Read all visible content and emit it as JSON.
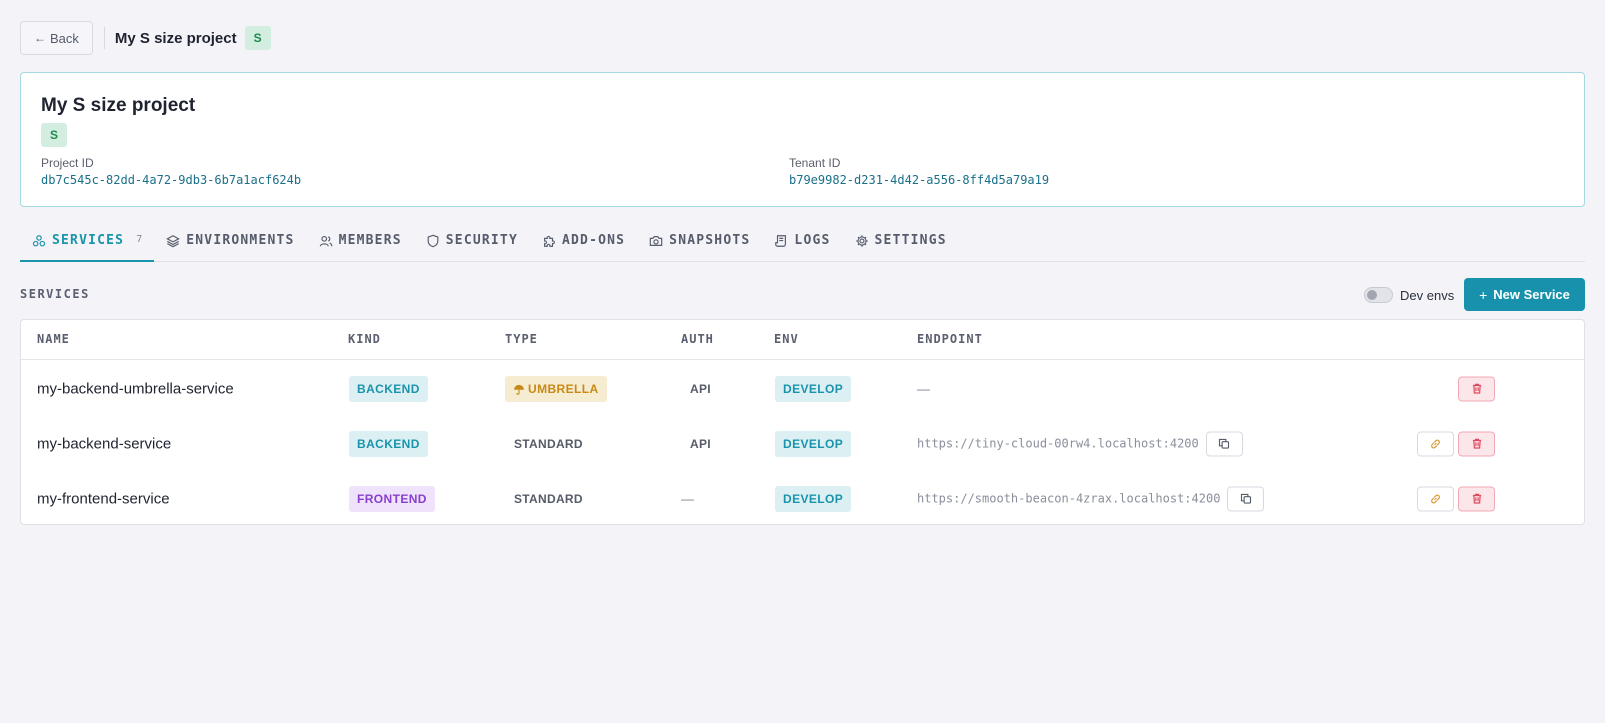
{
  "topbar": {
    "back_label": "Back",
    "back_arrow": "←",
    "title": "My S size project",
    "size_badge": "S"
  },
  "project": {
    "name": "My S size project",
    "size_badge": "S",
    "project_id_label": "Project ID",
    "project_id": "db7c545c-82dd-4a72-9db3-6b7a1acf624b",
    "tenant_id_label": "Tenant ID",
    "tenant_id": "b79e9982-d231-4d42-a556-8ff4d5a79a19"
  },
  "tabs": [
    {
      "label": "SERVICES",
      "icon": "services-icon",
      "count": "7",
      "active": true
    },
    {
      "label": "ENVIRONMENTS",
      "icon": "layers-icon"
    },
    {
      "label": "MEMBERS",
      "icon": "users-icon"
    },
    {
      "label": "SECURITY",
      "icon": "shield-icon"
    },
    {
      "label": "ADD-ONS",
      "icon": "puzzle-icon"
    },
    {
      "label": "SNAPSHOTS",
      "icon": "camera-icon"
    },
    {
      "label": "LOGS",
      "icon": "scroll-icon"
    },
    {
      "label": "SETTINGS",
      "icon": "gear-icon"
    }
  ],
  "section": {
    "title": "SERVICES",
    "toggle_label": "Dev envs",
    "new_button_label": "New Service",
    "new_button_icon": "+"
  },
  "table": {
    "columns": [
      "NAME",
      "KIND",
      "TYPE",
      "AUTH",
      "ENV",
      "ENDPOINT"
    ],
    "rows": [
      {
        "name": "my-backend-umbrella-service",
        "kind": "BACKEND",
        "type": "UMBRELLA",
        "type_icon": "umbrella-icon",
        "auth": "API",
        "env": "DEVELOP",
        "endpoint": "—"
      },
      {
        "name": "my-backend-service",
        "kind": "BACKEND",
        "type": "STANDARD",
        "auth": "API",
        "env": "DEVELOP",
        "endpoint": "https://tiny-cloud-00rw4.localhost:4200"
      },
      {
        "name": "my-frontend-service",
        "kind": "FRONTEND",
        "type": "STANDARD",
        "auth": "—",
        "env": "DEVELOP",
        "endpoint": "https://smooth-beacon-4zrax.localhost:4200"
      }
    ]
  },
  "colors": {
    "accent": "#1791ac",
    "backend": "#1a93ab",
    "frontend": "#8a3ecf",
    "umbrella": "#c78a17",
    "delete": "#e0485e",
    "link": "#e0a040"
  }
}
